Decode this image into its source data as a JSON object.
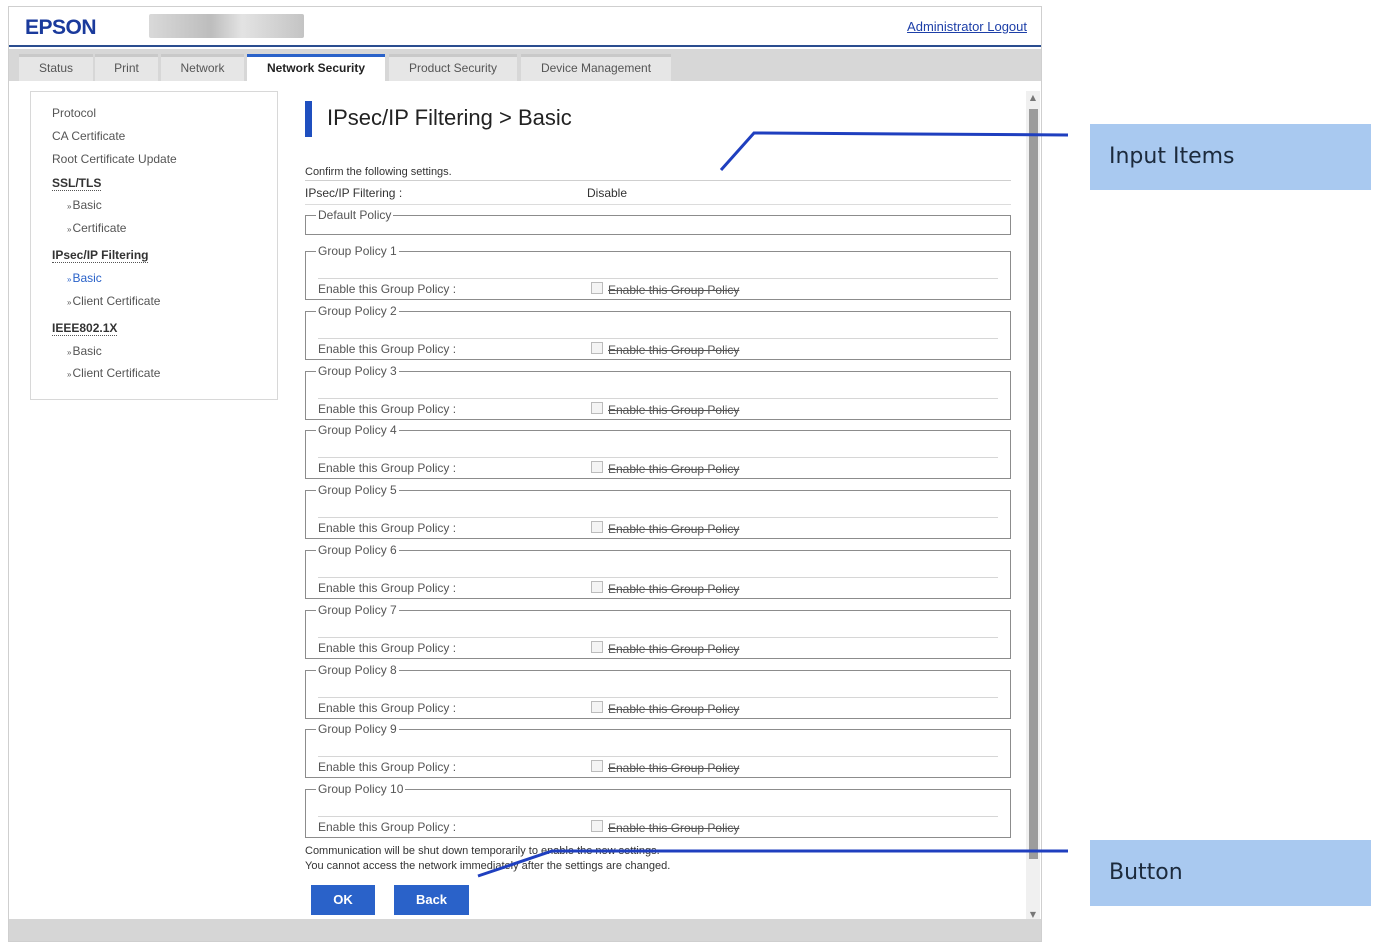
{
  "header": {
    "logo": "EPSON",
    "logout": "Administrator Logout"
  },
  "tabs": [
    {
      "label": "Status"
    },
    {
      "label": "Print"
    },
    {
      "label": "Network"
    },
    {
      "label": "Network Security"
    },
    {
      "label": "Product Security"
    },
    {
      "label": "Device Management"
    }
  ],
  "sidebar": {
    "items": [
      {
        "label": "Protocol"
      },
      {
        "label": "CA Certificate"
      },
      {
        "label": "Root Certificate Update"
      },
      {
        "label": "SSL/TLS"
      },
      {
        "label": "Basic"
      },
      {
        "label": "Certificate"
      },
      {
        "label": "IPsec/IP Filtering"
      },
      {
        "label": "Basic"
      },
      {
        "label": "Client Certificate"
      },
      {
        "label": "IEEE802.1X"
      },
      {
        "label": "Basic"
      },
      {
        "label": "Client Certificate"
      }
    ]
  },
  "main": {
    "title": "IPsec/IP Filtering > Basic",
    "confirm": "Confirm the following settings.",
    "ipf_label": "IPsec/IP Filtering :",
    "ipf_value": "Disable",
    "default_policy": "Default Policy",
    "group_policy_label": "Enable this Group Policy :",
    "group_policy_checkbox": "Enable this Group Policy",
    "groups": [
      {
        "legend": "Group Policy 1"
      },
      {
        "legend": "Group Policy 2"
      },
      {
        "legend": "Group Policy 3"
      },
      {
        "legend": "Group Policy 4"
      },
      {
        "legend": "Group Policy 5"
      },
      {
        "legend": "Group Policy 6"
      },
      {
        "legend": "Group Policy 7"
      },
      {
        "legend": "Group Policy 8"
      },
      {
        "legend": "Group Policy 9"
      },
      {
        "legend": "Group Policy 10"
      }
    ],
    "notice1": "Communication will be shut down temporarily to enable the new settings.",
    "notice2": "You cannot access the network immediately after the settings are changed.",
    "ok_label": "OK",
    "back_label": "Back"
  },
  "annotations": {
    "input_items": "Input Items",
    "button": "Button",
    "line_color": "#1f3fbf"
  }
}
